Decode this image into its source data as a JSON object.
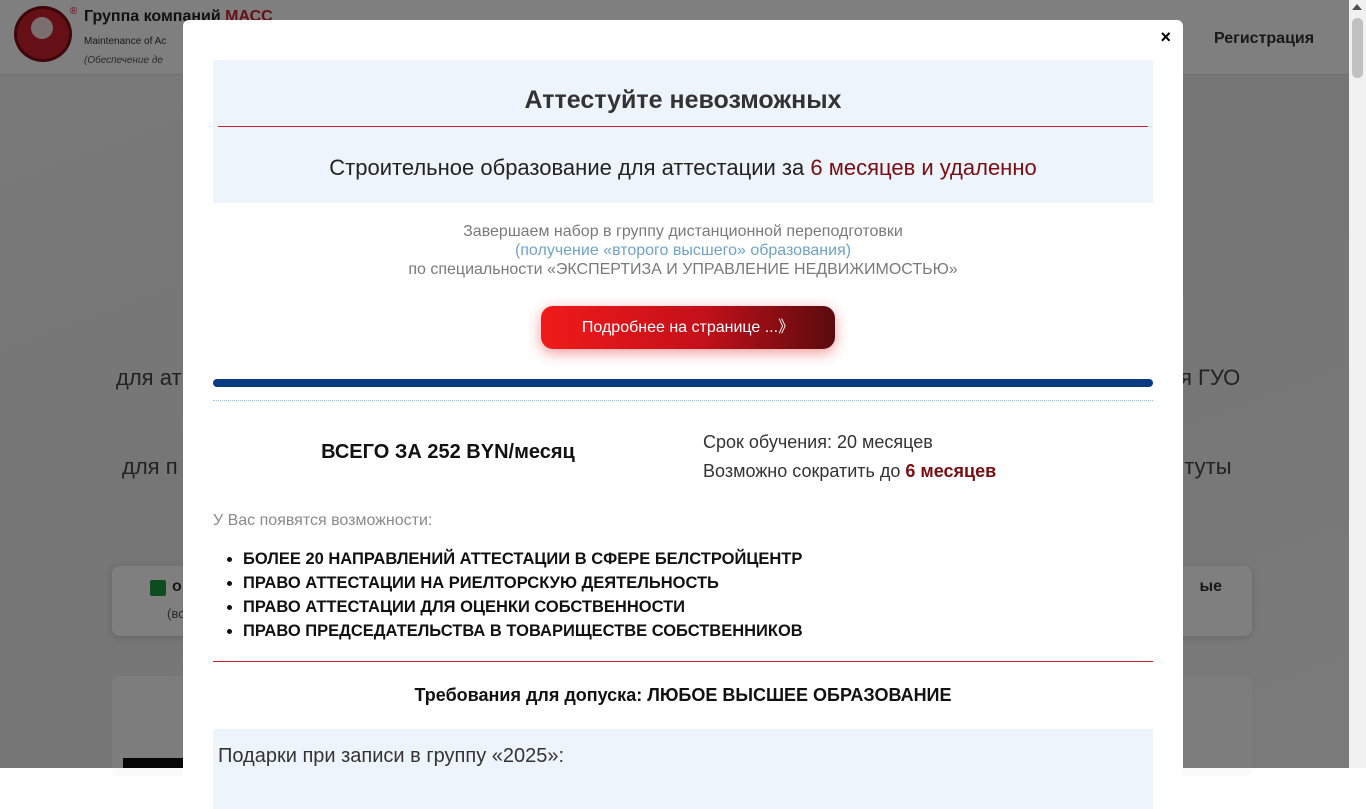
{
  "header": {
    "brand_prefix": "Группа компаний",
    "brand_accent": "МАСС",
    "reg_mark": "®",
    "sub_line1": "Maintenance of Ac",
    "sub_line2": "(Обеспечение де",
    "nav_register": "Регистрация"
  },
  "background": {
    "line1_left": "для ат",
    "line1_right": "я ГУО",
    "line2_left": "для п",
    "line2_right": "итуты",
    "card_left": "о",
    "card_sub": "(вс",
    "card_right": "ые"
  },
  "modal": {
    "close_label": "×",
    "hero_title": "Аттестуйте невозможных",
    "hero_sub_prefix": "Строительное образование для аттестации за",
    "hero_sub_accent": "6 месяцев и удаленно",
    "intro_line1": "Завершаем набор в группу дистанционной переподготовки",
    "intro_line2": "(получение «второго высшего» образования)",
    "intro_line3": "по специальности «ЭКСПЕРТИЗА И УПРАВЛЕНИЕ НЕДВИЖИМОСТЬЮ»",
    "cta_label": "Подробнее на странице ...》",
    "price": "ВСЕГО ЗА 252 BYN/месяц",
    "duration_line": "Срок обучения: 20 месяцев",
    "shorten_prefix": "Возможно сократить до",
    "shorten_accent": "6 месяцев",
    "opportunities_label": "У Вас появятся возможности:",
    "opportunities": [
      "БОЛЕЕ 20 НАПРАВЛЕНИЙ АТТЕСТАЦИИ В СФЕРЕ БЕЛСТРОЙЦЕНТР",
      "ПРАВО АТТЕСТАЦИИ НА РИЕЛТОРСКУЮ ДЕЯТЕЛЬНОСТЬ",
      "ПРАВО АТТЕСТАЦИИ ДЛЯ ОЦЕНКИ СОБСТВЕННОСТИ",
      "ПРАВО ПРЕДСЕДАТЕЛЬСТВА В ТОВАРИЩЕСТВЕ СОБСТВЕННИКОВ"
    ],
    "requirements": "Требования для допуска: ЛЮБОЕ ВЫСШЕЕ ОБРАЗОВАНИЕ",
    "gifts_title": "Подарки при записи в группу «2025»:"
  },
  "colors": {
    "accent_red": "#c8202c",
    "dark_red": "#7a0d12",
    "navy_bar": "#0a3a82",
    "hero_bg": "#eef4fc"
  },
  "icons": {
    "logo": "company-logo-icon",
    "check": "check-icon"
  }
}
